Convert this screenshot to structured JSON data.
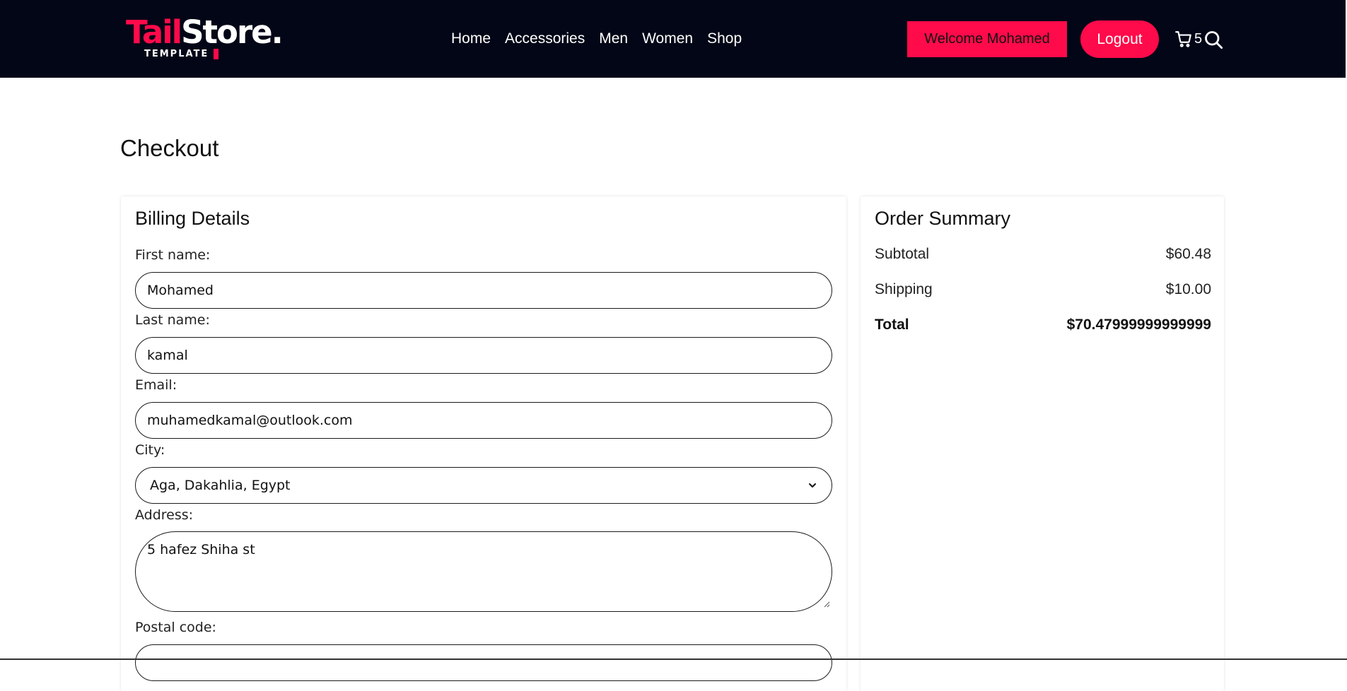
{
  "brand": {
    "logo_text_accent": "Tail",
    "logo_text_main": "Store.",
    "logo_subtitle": "TEMPLATE",
    "accent_color": "#ff0a4a",
    "header_bg": "#020617"
  },
  "nav": {
    "items": [
      "Home",
      "Accessories",
      "Men",
      "Women",
      "Shop"
    ]
  },
  "header": {
    "welcome_label": "Welcome Mohamed",
    "logout_label": "Logout",
    "cart_icon": "cart-icon",
    "cart_count": "5",
    "search_icon": "search-icon"
  },
  "page": {
    "title": "Checkout"
  },
  "billing": {
    "title": "Billing Details",
    "first_name_label": "First name:",
    "first_name_value": "Mohamed",
    "last_name_label": "Last name:",
    "last_name_value": "kamal",
    "email_label": "Email:",
    "email_value": "muhamedkamal@outlook.com",
    "city_label": "City:",
    "city_value": "Aga, Dakahlia, Egypt",
    "address_label": "Address:",
    "address_value": "5 hafez Shiha st",
    "postal_label": "Postal code:"
  },
  "summary": {
    "title": "Order Summary",
    "subtotal_label": "Subtotal",
    "subtotal_value": "$60.48",
    "shipping_label": "Shipping",
    "shipping_value": "$10.00",
    "total_label": "Total",
    "total_value": "$70.47999999999999"
  }
}
